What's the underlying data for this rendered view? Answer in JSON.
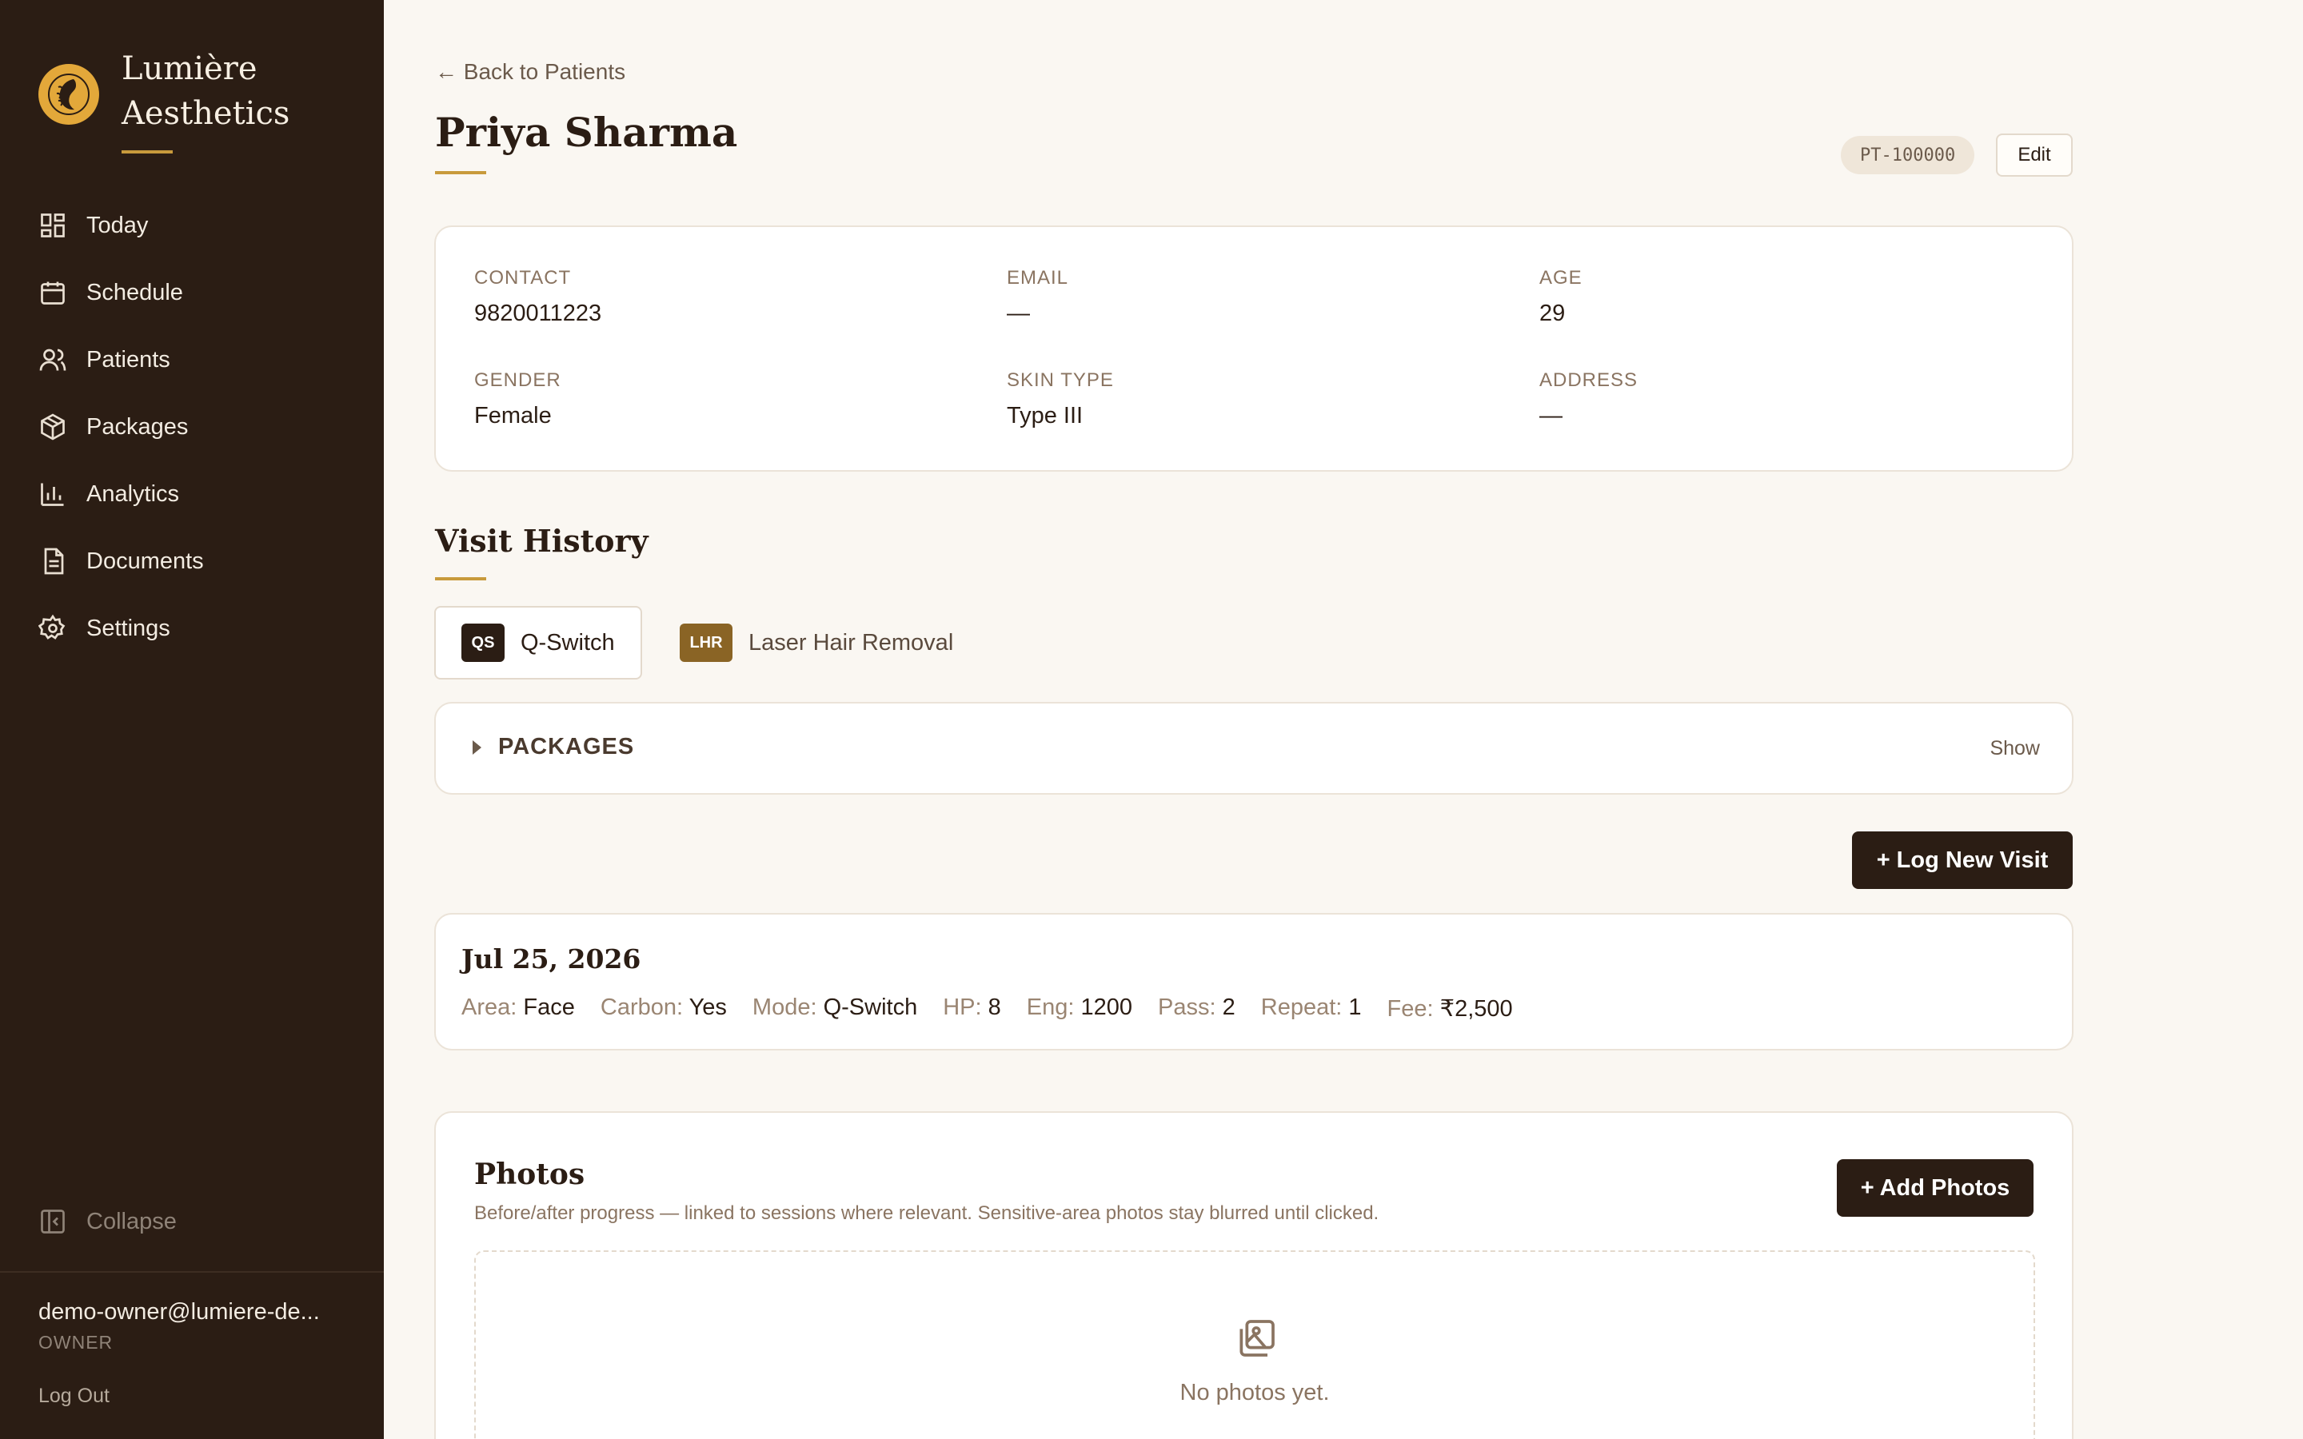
{
  "brand": {
    "name_line1": "Lumière",
    "name_line2": "Aesthetics"
  },
  "nav": {
    "items": [
      {
        "label": "Today",
        "icon": "grid-icon"
      },
      {
        "label": "Schedule",
        "icon": "calendar-icon"
      },
      {
        "label": "Patients",
        "icon": "users-icon"
      },
      {
        "label": "Packages",
        "icon": "box-icon"
      },
      {
        "label": "Analytics",
        "icon": "bar-chart-icon"
      },
      {
        "label": "Documents",
        "icon": "document-icon"
      },
      {
        "label": "Settings",
        "icon": "gear-icon"
      }
    ],
    "collapse_label": "Collapse"
  },
  "user": {
    "email": "demo-owner@lumiere-de...",
    "role": "OWNER",
    "logout_label": "Log Out"
  },
  "header": {
    "back_label": "← Back to Patients",
    "patient_name": "Priya Sharma",
    "patient_id": "PT-100000",
    "edit_label": "Edit"
  },
  "info": {
    "contact": {
      "label": "CONTACT",
      "value": "9820011223"
    },
    "email": {
      "label": "EMAIL",
      "value": "—"
    },
    "age": {
      "label": "AGE",
      "value": "29"
    },
    "gender": {
      "label": "GENDER",
      "value": "Female"
    },
    "skin_type": {
      "label": "SKIN TYPE",
      "value": "Type III"
    },
    "address": {
      "label": "ADDRESS",
      "value": "—"
    }
  },
  "visit_history": {
    "title": "Visit History",
    "tabs": [
      {
        "badge": "QS",
        "label": "Q-Switch",
        "badge_color": "#2b1d14",
        "active": true
      },
      {
        "badge": "LHR",
        "label": "Laser Hair Removal",
        "badge_color": "#8a6425",
        "active": false
      }
    ],
    "packages_label": "PACKAGES",
    "packages_toggle": "Show",
    "log_visit_label": "+ Log New Visit",
    "visits": [
      {
        "date": "Jul 25, 2026",
        "meta": [
          {
            "k": "Area:",
            "v": "Face"
          },
          {
            "k": "Carbon:",
            "v": "Yes"
          },
          {
            "k": "Mode:",
            "v": "Q-Switch"
          },
          {
            "k": "HP:",
            "v": "8"
          },
          {
            "k": "Eng:",
            "v": "1200"
          },
          {
            "k": "Pass:",
            "v": "2"
          },
          {
            "k": "Repeat:",
            "v": "1"
          },
          {
            "k": "Fee:",
            "v": "₹2,500"
          }
        ]
      }
    ]
  },
  "photos": {
    "title": "Photos",
    "subtitle": "Before/after progress — linked to sessions where relevant. Sensitive-area photos stay blurred until clicked.",
    "add_label": "+ Add Photos",
    "empty_text": "No photos yet."
  },
  "colors": {
    "sidebar": "#2b1d14",
    "accent": "#c89a3c",
    "background": "#faf7f2",
    "logo": "#e3a83a"
  }
}
